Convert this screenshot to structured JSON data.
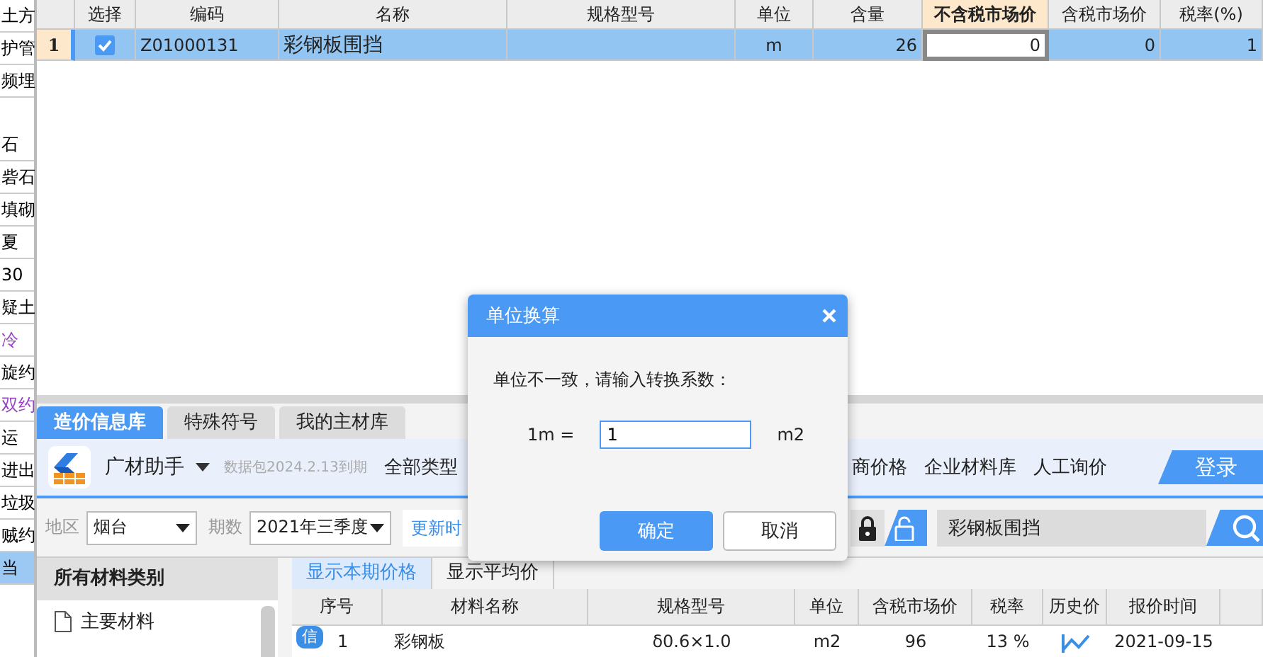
{
  "left_strip": [
    {
      "text": "土方",
      "color": "#000000",
      "selected": false
    },
    {
      "text": "护管",
      "color": "#000000",
      "selected": false
    },
    {
      "text": "频埋",
      "color": "#000000",
      "selected": false
    },
    {
      "text": "石",
      "color": "#000000",
      "selected": false
    },
    {
      "text": "砦石",
      "color": "#000000",
      "selected": false
    },
    {
      "text": "填砌",
      "color": "#000000",
      "selected": false
    },
    {
      "text": "夏",
      "color": "#000000",
      "selected": false
    },
    {
      "text": "30",
      "color": "#000000",
      "selected": false
    },
    {
      "text": "疑土",
      "color": "#000000",
      "selected": false
    },
    {
      "text": "冷",
      "color": "#9a3fc8",
      "selected": false
    },
    {
      "text": "旋约",
      "color": "#000000",
      "selected": false
    },
    {
      "text": "双约",
      "color": "#9a3fc8",
      "selected": false
    },
    {
      "text": "运",
      "color": "#000000",
      "selected": false
    },
    {
      "text": "进出",
      "color": "#000000",
      "selected": false
    },
    {
      "text": "垃圾",
      "color": "#000000",
      "selected": false
    },
    {
      "text": "贼约",
      "color": "#000000",
      "selected": false
    },
    {
      "text": "当",
      "color": "#000000",
      "selected": true
    }
  ],
  "grid": {
    "columns": [
      {
        "label": "选择",
        "active": false
      },
      {
        "label": "编码",
        "active": false
      },
      {
        "label": "名称",
        "active": false
      },
      {
        "label": "规格型号",
        "active": false
      },
      {
        "label": "单位",
        "active": false
      },
      {
        "label": "含量",
        "active": false
      },
      {
        "label": "不含税市场价",
        "active": true
      },
      {
        "label": "含税市场价",
        "active": false
      },
      {
        "label": "税率(%)",
        "active": false
      }
    ],
    "rows": [
      {
        "number": "1",
        "checked": true,
        "selected": true,
        "code": "Z01000131",
        "name": "彩钢板围挡",
        "unit": "m",
        "amount": "26",
        "price_ex_tax": "0",
        "price_tax": "0",
        "tax_rate": "1"
      }
    ]
  },
  "tabs": [
    {
      "label": "造价信息库",
      "selected": true
    },
    {
      "label": "特殊符号",
      "selected": false
    },
    {
      "label": "我的主材库",
      "selected": false
    }
  ],
  "toolbar": {
    "brand": "广材助手",
    "package_note": "数据包2024.2.13到期",
    "links": [
      "全部类型",
      "商价格",
      "企业材料库",
      "人工询价"
    ],
    "login": "登录"
  },
  "filters": {
    "region_label": "地区",
    "region": "烟台",
    "period_label": "期数",
    "period": "2021年三季度",
    "update_link": "更新时",
    "search": {
      "value": "彩钢板围挡"
    }
  },
  "categories": {
    "title": "所有材料类别",
    "items": [
      "主要材料"
    ]
  },
  "price_tabs": [
    {
      "label": "显示本期价格",
      "selected": true
    },
    {
      "label": "显示平均价",
      "selected": false
    }
  ],
  "price_table": {
    "columns": [
      "序号",
      "材料名称",
      "规格型号",
      "单位",
      "含税市场价",
      "税率",
      "历史价",
      "报价时间"
    ],
    "rows": [
      {
        "badge": "信",
        "number": "1",
        "name": "彩钢板",
        "spec": "δ0.6×1.0",
        "unit": "m2",
        "price": "96",
        "tax_rate": "13 %",
        "date": "2021-09-15"
      }
    ]
  },
  "dialog": {
    "title": "单位换算",
    "message": "单位不一致，请输入转换系数：",
    "from_label": "1m =",
    "value": "1",
    "to_unit": "m2",
    "buttons": [
      {
        "label": "确定",
        "kind": "primary"
      },
      {
        "label": "取消",
        "kind": "secondary"
      }
    ]
  }
}
